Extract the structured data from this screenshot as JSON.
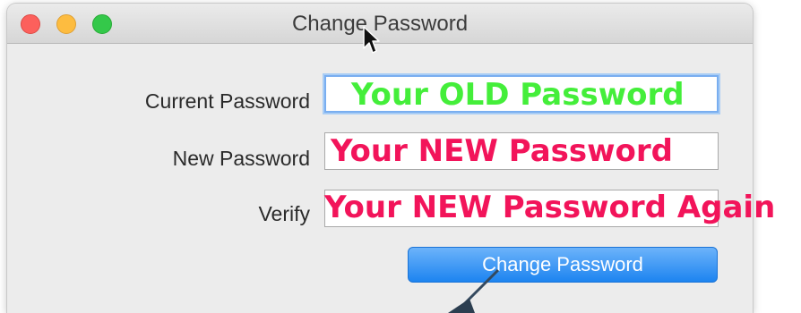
{
  "window": {
    "title": "Change Password"
  },
  "form": {
    "current_password": {
      "label": "Current Password",
      "value": "Your OLD Password"
    },
    "new_password": {
      "label": "New Password",
      "value": "Your NEW Password"
    },
    "verify": {
      "label": "Verify",
      "value": "Your NEW Password Again"
    },
    "submit_label": "Change Password"
  },
  "colors": {
    "old_annotation": "#44ee3a",
    "new_annotation": "#f2145a",
    "button": "#2f8ff3",
    "focus_ring": "#79aef0"
  },
  "icons": [
    "close-icon",
    "minimize-icon",
    "zoom-icon",
    "mouse-pointer-icon",
    "callout-arrow-icon"
  ]
}
